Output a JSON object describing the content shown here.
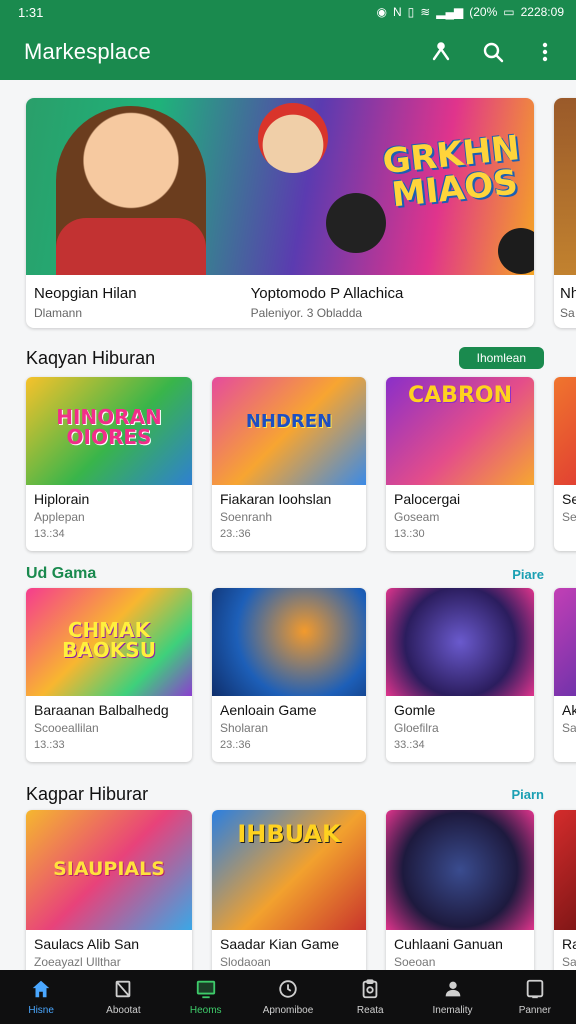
{
  "status": {
    "time": "1:31",
    "battery": "(20%",
    "clock": "2228:09"
  },
  "app": {
    "title": "Markesplace"
  },
  "featured": [
    {
      "art_text": "GRKHN MIAOS",
      "left_title": "Neopgian Hilan",
      "left_sub": "Dlamann",
      "right_title": "Yoptomodo P Allachica",
      "right_sub": "Paleniyor. 3 Obladda"
    },
    {
      "left_title": "Nh",
      "left_sub": "Sa"
    }
  ],
  "section1": {
    "title": "Kaqyan Hiburan",
    "button": "Ihomlean",
    "cards": [
      {
        "art_text": "HINORAN OIORES",
        "title": "Hiplorain",
        "sub": "Applepan",
        "meta": "13.:34"
      },
      {
        "art_text": "NHDREN",
        "title": "Fiakaran Ioohslan",
        "sub": "Soenranh",
        "meta": "23.:36"
      },
      {
        "art_text": "CABRON",
        "title": "Palocergai",
        "sub": "Goseam",
        "meta": "13.:30"
      },
      {
        "title": "Se",
        "sub": "Se",
        "meta": ""
      }
    ]
  },
  "section2": {
    "title": "Ud Gama",
    "link": "Piare",
    "cards": [
      {
        "art_text": "CHMAK BAOKSU",
        "title": "Baraanan Balbalhedg",
        "sub": "Scooeallilan",
        "meta": "13.:33"
      },
      {
        "title": "Aenloain Game",
        "sub": "Sholaran",
        "meta": "23.:36"
      },
      {
        "title": "Gomle",
        "sub": "Gloefilra",
        "meta": "33.:34"
      },
      {
        "title": "Ak",
        "sub": "Sa",
        "meta": ""
      }
    ]
  },
  "section3": {
    "title": "Kagpar Hiburar",
    "link": "Piarn",
    "cards": [
      {
        "art_text": "SIAUPIALS",
        "title": "Saulacs Alib San",
        "sub": "Zoeayazl Ullthar",
        "meta": ""
      },
      {
        "art_text": "IHBUAK",
        "title": "Saadar Kian Game",
        "sub": "Slodaoan",
        "meta": ""
      },
      {
        "title": "Cuhlaani Ganuan",
        "sub": "Soeoan",
        "meta": ""
      },
      {
        "title": "Ra",
        "sub": "Sa",
        "meta": ""
      }
    ]
  },
  "nav": [
    {
      "label": "Hisne",
      "icon": "home-icon"
    },
    {
      "label": "Abootat",
      "icon": "slash-icon"
    },
    {
      "label": "Heoms",
      "icon": "tv-icon"
    },
    {
      "label": "Apnomiboe",
      "icon": "clock-icon"
    },
    {
      "label": "Reata",
      "icon": "clipboard-icon"
    },
    {
      "label": "Inemality",
      "icon": "people-icon"
    },
    {
      "label": "Panner",
      "icon": "tablet-icon"
    }
  ],
  "colors": {
    "brand": "#1a8a4e",
    "link": "#1a9fb3",
    "nav_active": "#4aa7ff"
  }
}
